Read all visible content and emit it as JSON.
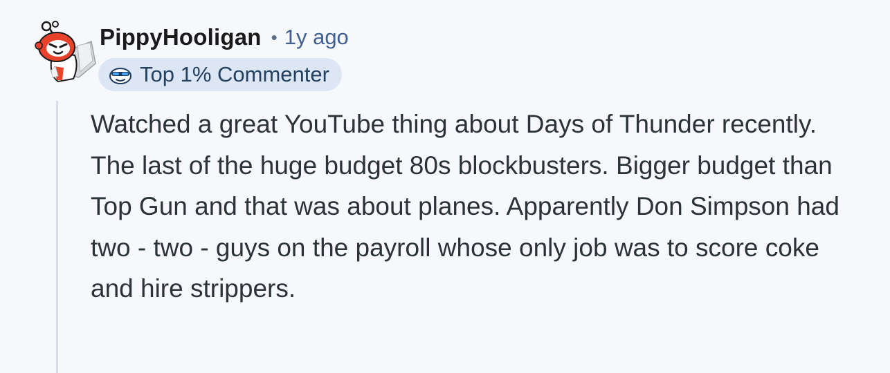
{
  "comment": {
    "author": "PippyHooligan",
    "separator": "•",
    "timestamp": "1y ago",
    "avatar_icon": "snoo-avatar-icon",
    "flair": {
      "icon": "snoo-sunglasses-icon",
      "label": "Top 1% Commenter"
    },
    "body": "Watched a great YouTube thing about Days of Thunder recently. The last of the huge budget 80s blockbusters. Bigger budget than Top Gun and that was about planes. Apparently Don Simpson had two - two - guys on the payroll whose only job was to score coke and hire strippers."
  },
  "colors": {
    "background": "#f6f8fc",
    "username": "#1a1a1b",
    "timestamp": "#41608f",
    "flair_background": "#dce6f5",
    "flair_text": "#24415f",
    "body_text": "#2b3338",
    "thread_line": "#d6dde8",
    "avatar_red": "#e8432a"
  }
}
